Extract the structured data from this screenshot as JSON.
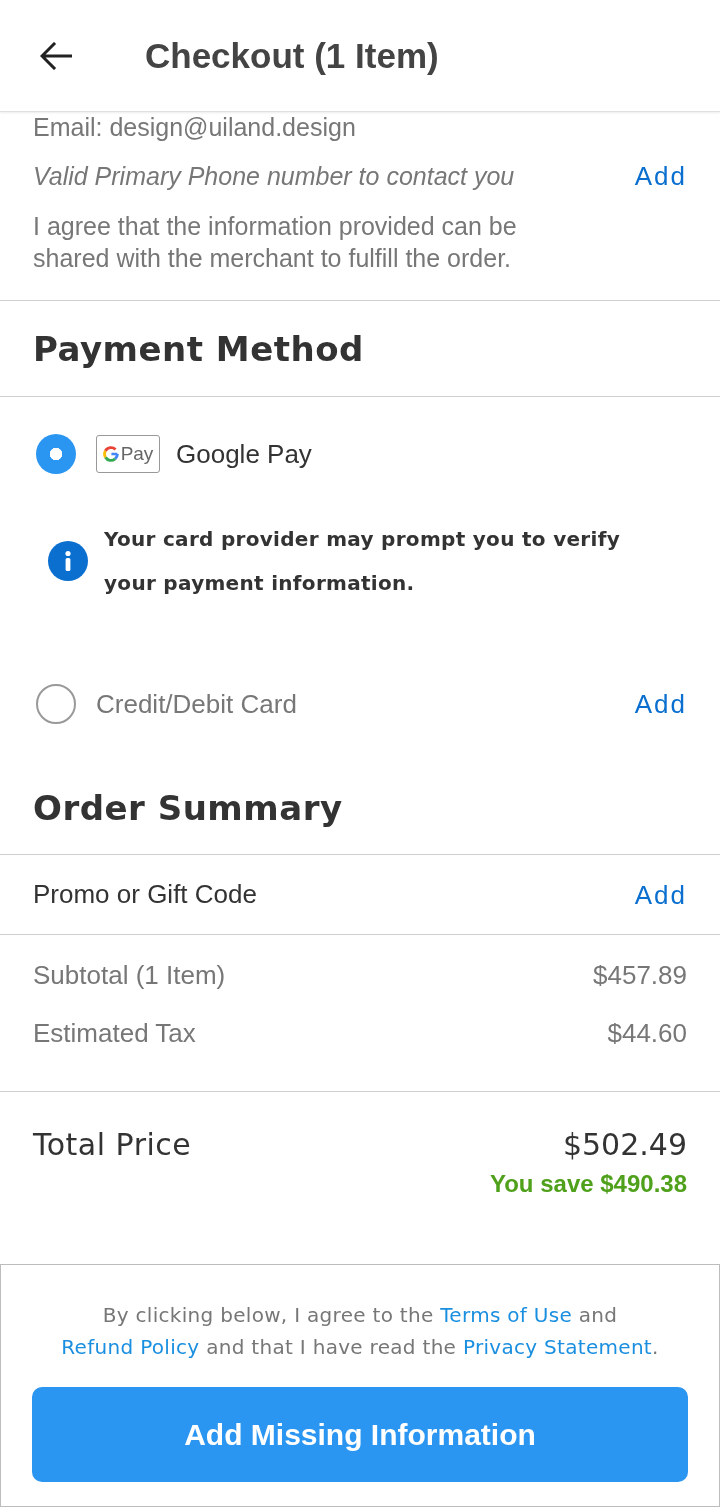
{
  "header": {
    "title": "Checkout (1 Item)"
  },
  "contact": {
    "email": "Email: design@uiland.design",
    "phone_prompt": "Valid Primary Phone number to contact you",
    "phone_action": "Add",
    "consent": "I agree that the information provided can be shared with the merchant to fulfill the order."
  },
  "payment": {
    "title": "Payment Method",
    "options": [
      {
        "kind": "wallet",
        "label": "Google Pay",
        "selected": true,
        "logo_text": "Pay",
        "notice": "Your card provider may prompt you to verify your payment information."
      },
      {
        "kind": "card",
        "label": "Credit/Debit Card",
        "selected": false,
        "action": "Add"
      }
    ]
  },
  "summary": {
    "title": "Order Summary",
    "promo": {
      "label": "Promo or Gift Code",
      "action": "Add"
    },
    "lines": [
      {
        "label": "Subtotal (1 Item)",
        "value": "$457.89"
      },
      {
        "label": "Estimated Tax",
        "value": "$44.60"
      }
    ],
    "total": {
      "label": "Total Price",
      "value": "$502.49",
      "savings": "You save $490.38"
    }
  },
  "footer": {
    "legal": [
      {
        "kind": "text",
        "text": "By clicking below, I agree to the "
      },
      {
        "kind": "link",
        "text": "Terms of Use"
      },
      {
        "kind": "text",
        "text": " and "
      },
      {
        "kind": "link",
        "text": "Refund Policy"
      },
      {
        "kind": "text",
        "text": " and that I have read the "
      },
      {
        "kind": "link",
        "text": "Privacy Statement"
      },
      {
        "kind": "text",
        "text": "."
      }
    ],
    "button": "Add Missing Information"
  }
}
